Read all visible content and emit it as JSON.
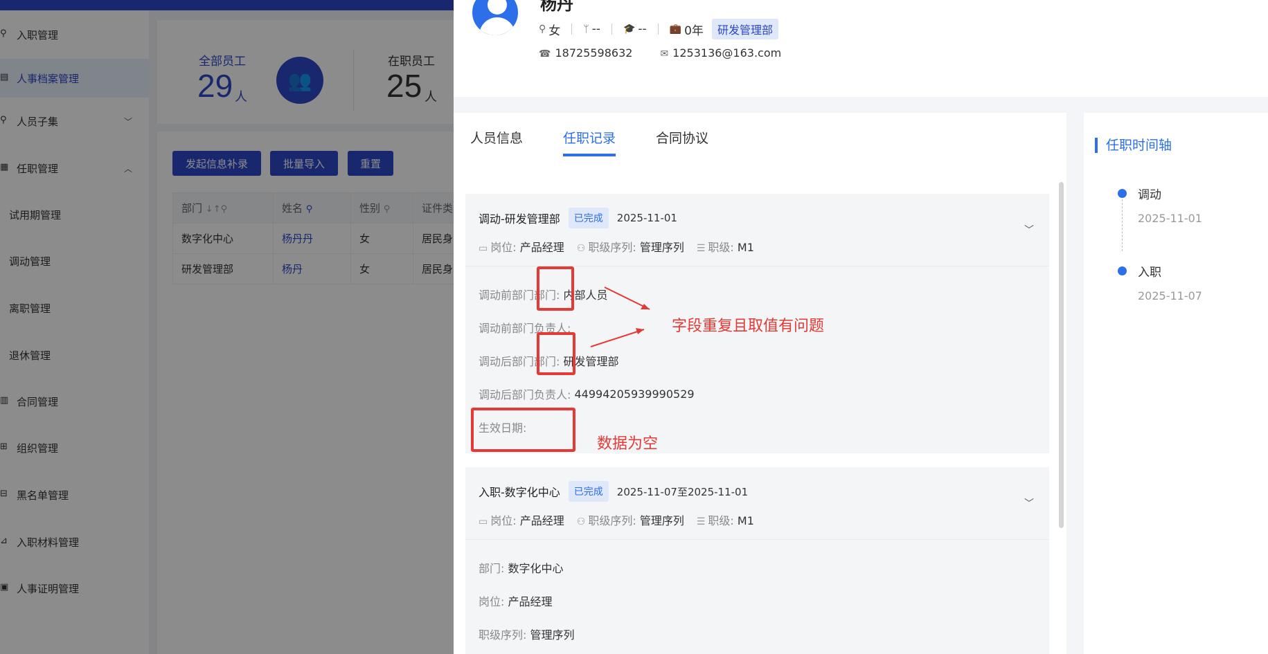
{
  "sidebar": {
    "items": [
      {
        "label": "入职管理",
        "icon": "person-icon"
      },
      {
        "label": "人事档案管理",
        "icon": "file-icon"
      },
      {
        "label": "人员子集",
        "icon": "person-icon"
      },
      {
        "label": "任职管理",
        "icon": "grid-icon"
      },
      {
        "label": "试用期管理"
      },
      {
        "label": "调动管理"
      },
      {
        "label": "离职管理"
      },
      {
        "label": "退休管理"
      },
      {
        "label": "合同管理",
        "icon": "contract-icon"
      },
      {
        "label": "组织管理",
        "icon": "org-icon"
      },
      {
        "label": "黑名单管理",
        "icon": "blacklist-icon"
      },
      {
        "label": "入职材料管理",
        "icon": "material-icon"
      },
      {
        "label": "人事证明管理",
        "icon": "certificate-icon"
      }
    ]
  },
  "stats": {
    "total_label": "全部员工",
    "total_value": "29",
    "total_unit": "人",
    "active_label": "在职员工",
    "active_value": "25",
    "active_unit": "人"
  },
  "actions": {
    "supplement": "发起信息补录",
    "import": "批量导入",
    "reset": "重置"
  },
  "table": {
    "headers": [
      "部门",
      "姓名",
      "性别",
      "证件类"
    ],
    "rows": [
      [
        "数字化中心",
        "杨丹丹",
        "女",
        "居民身"
      ],
      [
        "研发管理部",
        "杨丹",
        "女",
        "居民身"
      ]
    ]
  },
  "profile": {
    "name": "杨丹",
    "gender": "女",
    "field2": "--",
    "education": "--",
    "years": "0年",
    "department": "研发管理部",
    "phone": "18725598632",
    "email": "1253136@163.com"
  },
  "tabs": [
    "人员信息",
    "任职记录",
    "合同协议"
  ],
  "records": [
    {
      "title": "调动-研发管理部",
      "status": "已完成",
      "date": "2025-11-01",
      "position_label": "岗位:",
      "position": "产品经理",
      "sequence_label": "职级序列:",
      "sequence": "管理序列",
      "grade_label": "职级:",
      "grade": "M1",
      "fields": [
        {
          "k": "调动前部门部门:",
          "v": "内部人员"
        },
        {
          "k": "调动前部门负责人:",
          "v": ""
        },
        {
          "k": "调动后部门部门:",
          "v": "研发管理部"
        },
        {
          "k": "调动后部门负责人:",
          "v": "44994205939990529"
        },
        {
          "k": "生效日期:",
          "v": ""
        }
      ]
    },
    {
      "title": "入职-数字化中心",
      "status": "已完成",
      "date": "2025-11-07至2025-11-01",
      "position_label": "岗位:",
      "position": "产品经理",
      "sequence_label": "职级序列:",
      "sequence": "管理序列",
      "grade_label": "职级:",
      "grade": "M1",
      "fields": [
        {
          "k": "部门:",
          "v": "数字化中心"
        },
        {
          "k": "岗位:",
          "v": "产品经理"
        },
        {
          "k": "职级序列:",
          "v": "管理序列"
        }
      ]
    }
  ],
  "annotations": {
    "dup_note": "字段重复且取值有问题",
    "empty_note": "数据为空"
  },
  "timeline": {
    "title": "任职时间轴",
    "events": [
      {
        "label": "调动",
        "date": "2025-11-01"
      },
      {
        "label": "入职",
        "date": "2025-11-07"
      }
    ]
  },
  "colors": {
    "accent": "#2c6fe8",
    "brand": "#2c47c9",
    "annotation": "#e53935"
  }
}
